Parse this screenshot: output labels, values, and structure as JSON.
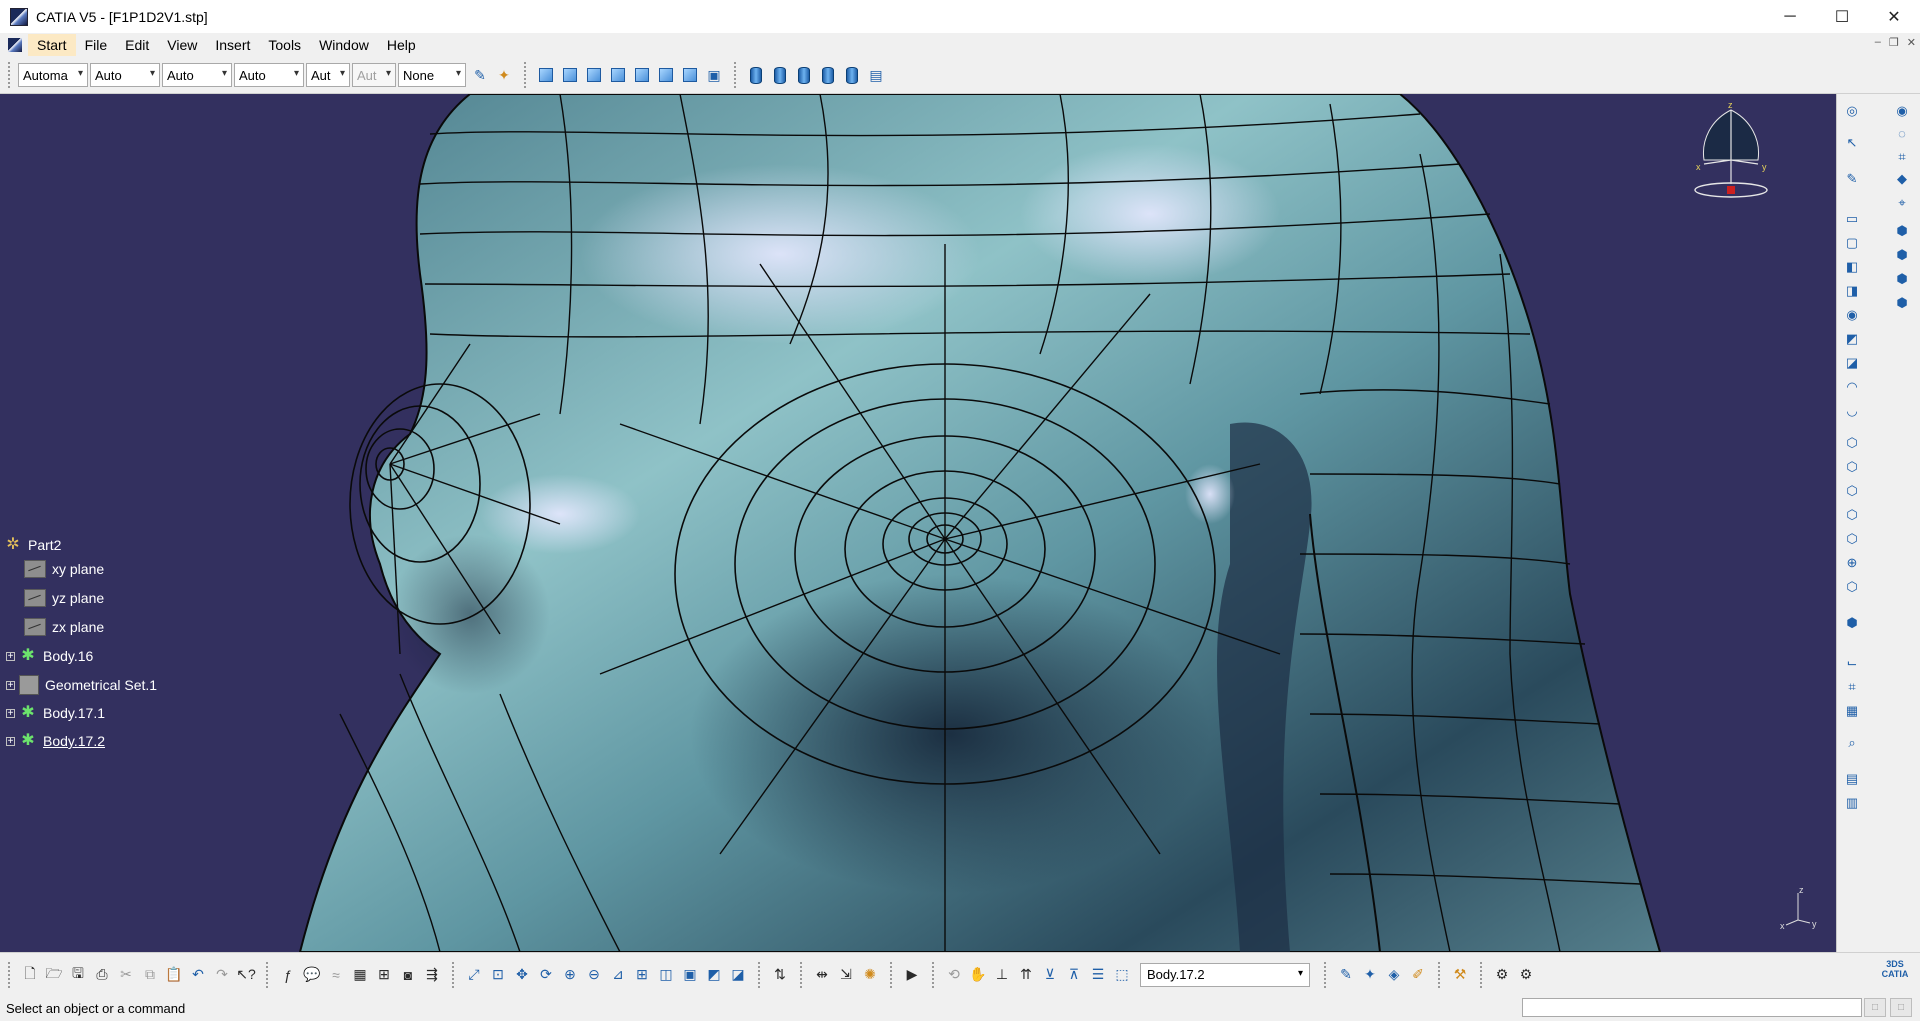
{
  "window": {
    "title": "CATIA V5 - [F1P1D2V1.stp]",
    "minimize_glyph": "─",
    "maximize_glyph": "☐",
    "close_glyph": "✕",
    "mdi_minimize": "–",
    "mdi_restore": "❐",
    "mdi_close": "✕"
  },
  "menu": {
    "items": [
      {
        "label": "Start",
        "active": true
      },
      {
        "label": "File"
      },
      {
        "label": "Edit"
      },
      {
        "label": "View"
      },
      {
        "label": "Insert"
      },
      {
        "label": "Tools"
      },
      {
        "label": "Window"
      },
      {
        "label": "Help"
      }
    ]
  },
  "toolbar_top": {
    "combos": [
      {
        "value": "Automa",
        "disabled": false
      },
      {
        "value": "Auto",
        "disabled": false
      },
      {
        "value": "Auto",
        "disabled": false
      },
      {
        "value": "Auto",
        "disabled": false
      },
      {
        "value": "Aut",
        "disabled": false
      },
      {
        "value": "Aut",
        "disabled": true
      },
      {
        "value": "None",
        "disabled": false
      }
    ],
    "icons": [
      "brush-icon",
      "paint-icon",
      "view-iso-icon",
      "view-front-icon",
      "view-back-icon",
      "view-left-icon",
      "view-right-icon",
      "view-top-icon",
      "view-bottom-icon",
      "named-views-icon",
      "shading-icon",
      "shading-edges-icon",
      "shading-no-edges-icon",
      "wireframe-icon",
      "custom-view-icon",
      "view-params-icon"
    ]
  },
  "tree": {
    "items": [
      {
        "label": "Part2",
        "type": "root",
        "expandable": false,
        "selected": false
      },
      {
        "label": "xy plane",
        "type": "plane",
        "expandable": false,
        "selected": false
      },
      {
        "label": "yz plane",
        "type": "plane",
        "expandable": false,
        "selected": false
      },
      {
        "label": "zx plane",
        "type": "plane",
        "expandable": false,
        "selected": false
      },
      {
        "label": "Body.16",
        "type": "body",
        "expandable": true,
        "selected": false
      },
      {
        "label": "Geometrical Set.1",
        "type": "geoset",
        "expandable": true,
        "selected": false
      },
      {
        "label": "Body.17.1",
        "type": "body",
        "expandable": true,
        "selected": false
      },
      {
        "label": "Body.17.2",
        "type": "body",
        "expandable": true,
        "selected": true
      }
    ]
  },
  "compass": {
    "x_label": "x",
    "y_label": "y",
    "z_label": "z"
  },
  "axis_mini": {
    "x_label": "x",
    "y_label": "y",
    "z_label": "z"
  },
  "toolbar_bottom": {
    "current_body": "Body.17.2"
  },
  "status": {
    "message": "Select an object or a command",
    "input_value": ""
  },
  "colors": {
    "viewport_bg": "#33305f",
    "surface": "#6d9aa3",
    "mesh_line": "#0a0a0a",
    "tree_text": "#ffffff",
    "accent": "#1f5fa8"
  }
}
